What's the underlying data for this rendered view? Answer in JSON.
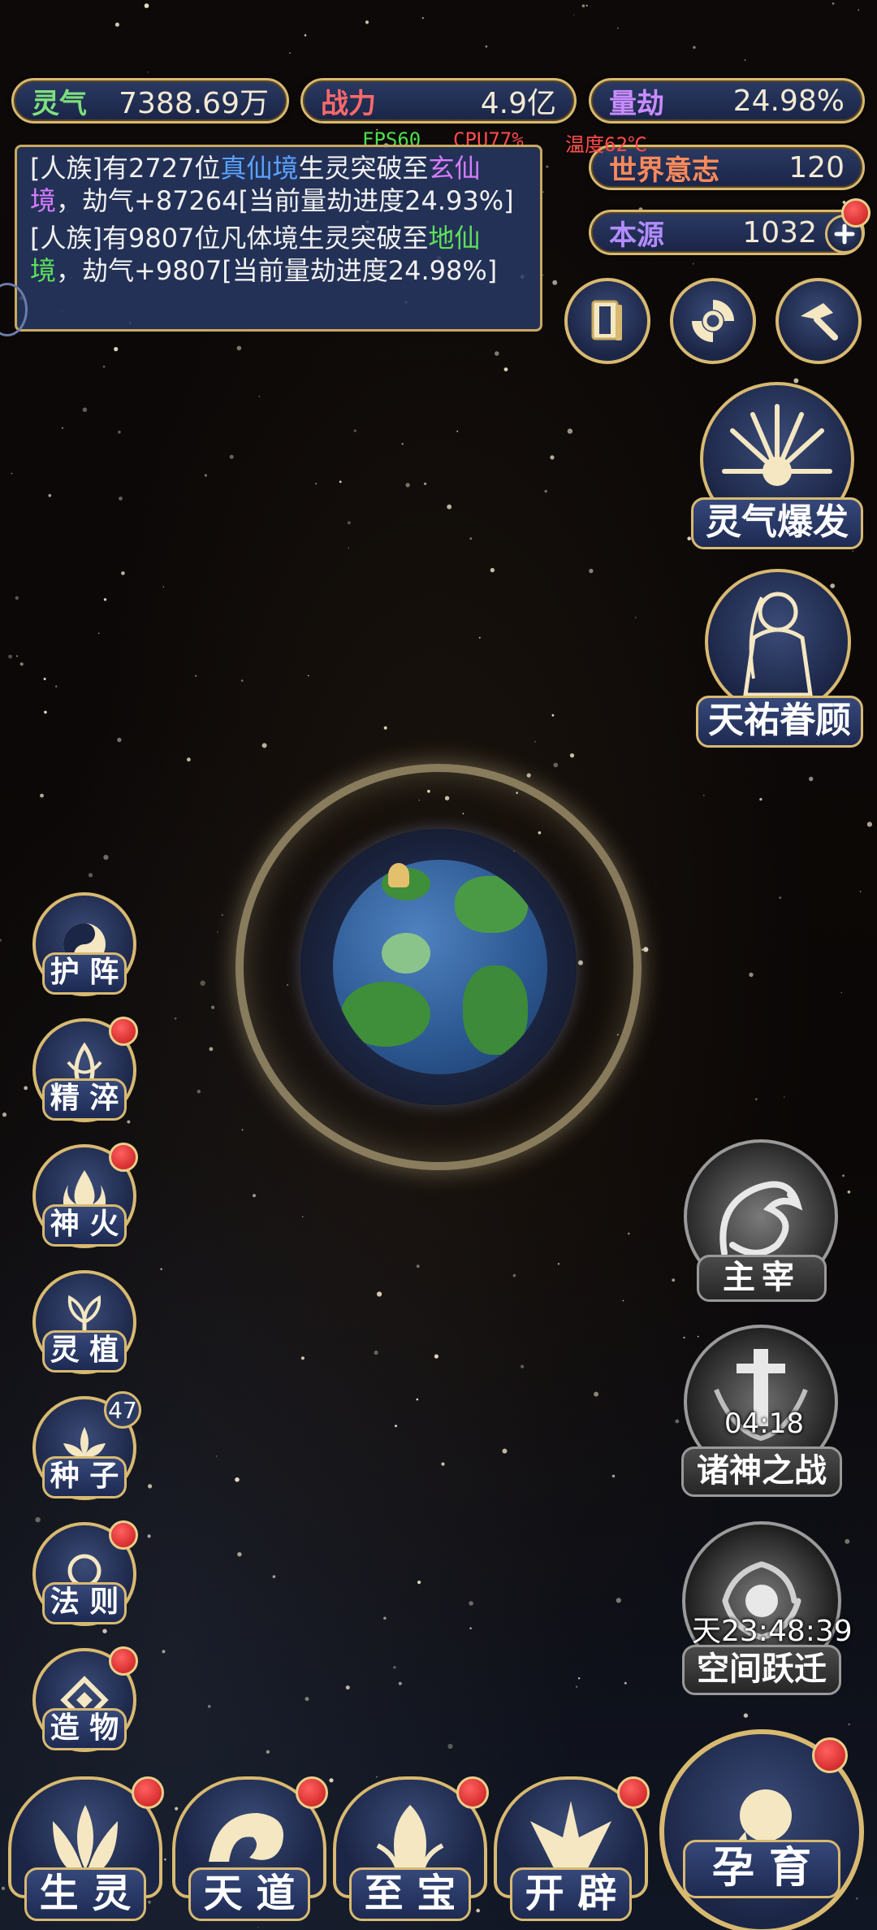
{
  "stats": {
    "lingqi": {
      "label": "灵气",
      "value": "7388.69万"
    },
    "zhanli": {
      "label": "战力",
      "value": "4.9亿"
    },
    "liangjie": {
      "label": "量劫",
      "value": "24.98%"
    },
    "shijie": {
      "label": "世界意志",
      "value": "120"
    },
    "benyuan": {
      "label": "本源",
      "value": "1032"
    }
  },
  "hud": {
    "fps": "FPS60",
    "cpu": "CPU77%",
    "temp": "温度62℃"
  },
  "log": {
    "line1": {
      "a": "[人族]有2727位",
      "b": "真仙境",
      "c": "生灵突破至",
      "d": "玄仙境",
      "e": "，劫气+87264[当前量劫进度24.93%]"
    },
    "line2": {
      "a": "[人族]有9807位凡体境生灵突破至",
      "b": "地仙境",
      "c": "，劫气+9807[当前量劫进度24.98%]"
    }
  },
  "right_actions": {
    "burst": "灵气爆发",
    "bless": "天祐眷顾",
    "ruler": "主宰",
    "war": "诸神之战",
    "war_timer": "04:18",
    "leap": "空间跃迁",
    "leap_timer": "天23:48:39"
  },
  "left_menu": {
    "hu_zhen": "护 阵",
    "jing_cui": "精 淬",
    "shen_huo": "神 火",
    "ling_zhi": "灵 植",
    "zhong_zi": "种 子",
    "zhong_zi_count": "47",
    "fa_ze": "法 则",
    "zao_wu": "造 物"
  },
  "bottom_nav": {
    "sheng_ling": "生 灵",
    "tian_dao": "天 道",
    "zhi_bao": "至 宝",
    "kai_pi": "开 辟",
    "yun_yu": "孕 育"
  },
  "colors": {
    "gold": "#d8b970",
    "panel": "#1a2447",
    "accent_green": "#5ce05c",
    "accent_purple": "#d57cff",
    "accent_blue": "#5aa2ff"
  }
}
